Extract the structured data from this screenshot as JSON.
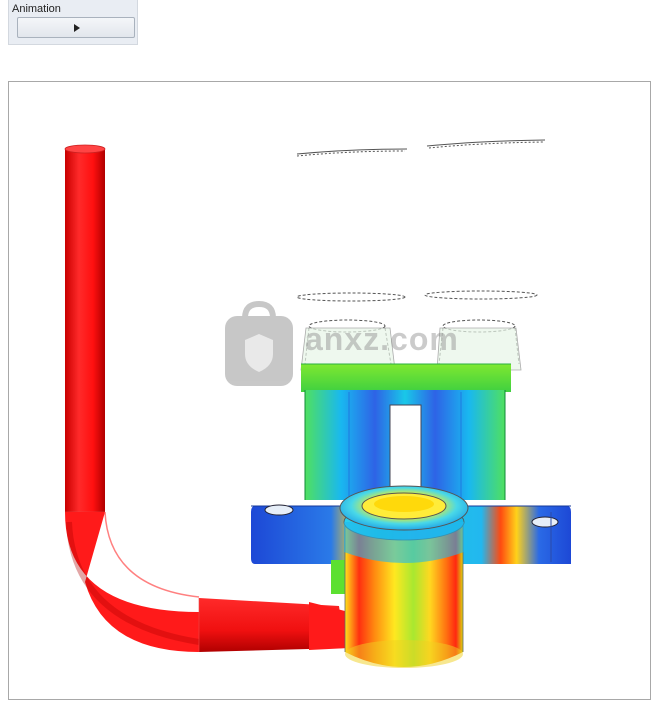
{
  "animation_panel": {
    "title": "Animation",
    "play_button_icon": "play-icon"
  },
  "viewport": {
    "model": "casting-part-with-pipe",
    "colors": {
      "pipe": "#ff1a1a",
      "low": "#1f4fd8",
      "mid_low": "#19c8e8",
      "mid": "#3fe03f",
      "mid_high": "#f5ee1a",
      "high": "#ff2a10"
    },
    "watermark": {
      "text": "anxz.com",
      "icon": "shield-icon"
    }
  }
}
